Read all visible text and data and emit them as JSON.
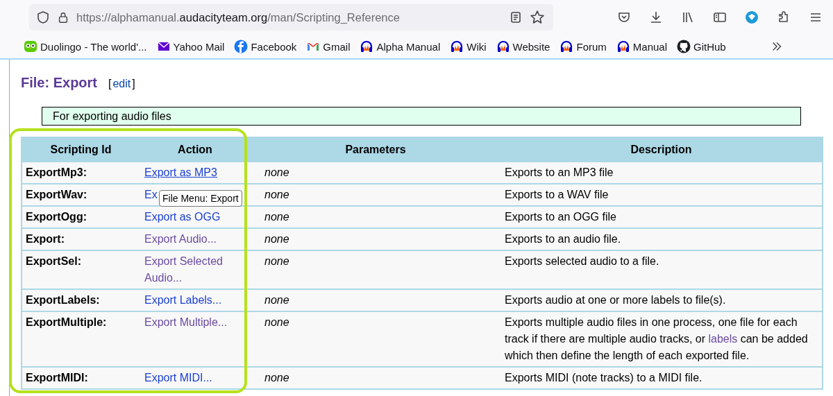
{
  "browser": {
    "url": {
      "prefix": "https://alphamanual.",
      "domain": "audacityteam.org",
      "path": "/man/Scripting_Reference"
    },
    "bookmarks": [
      {
        "label": "Duolingo - The world'..."
      },
      {
        "label": "Yahoo Mail"
      },
      {
        "label": "Facebook"
      },
      {
        "label": "Gmail"
      },
      {
        "label": "Alpha Manual"
      },
      {
        "label": "Wiki"
      },
      {
        "label": "Website"
      },
      {
        "label": "Forum"
      },
      {
        "label": "Manual"
      },
      {
        "label": "GitHub"
      }
    ]
  },
  "heading": {
    "title": "File: Export",
    "edit_open": "[",
    "edit_link": "edit",
    "edit_close": "]"
  },
  "note": "For exporting audio files",
  "table": {
    "columns": [
      "Scripting Id",
      "Action",
      "Parameters",
      "Description"
    ],
    "rows": [
      {
        "id": "ExportMp3:",
        "action": {
          "text": "Export as MP3",
          "visited": false,
          "hovered": true
        },
        "parameters": "none",
        "description": [
          {
            "text": "Exports to an MP3 file",
            "link": false
          }
        ]
      },
      {
        "id": "ExportWav:",
        "action": {
          "text": "Ex",
          "visited": false,
          "hovered": false
        },
        "tooltip": "File Menu: Export",
        "parameters": "none",
        "description": [
          {
            "text": "Exports to a WAV file",
            "link": false
          }
        ]
      },
      {
        "id": "ExportOgg:",
        "action": {
          "text": "Export as OGG",
          "visited": false,
          "hovered": false
        },
        "parameters": "none",
        "description": [
          {
            "text": "Exports to an OGG file",
            "link": false
          }
        ]
      },
      {
        "id": "Export:",
        "action": {
          "text": "Export Audio...",
          "visited": true,
          "hovered": false
        },
        "parameters": "none",
        "description": [
          {
            "text": "Exports to an audio file.",
            "link": false
          }
        ]
      },
      {
        "id": "ExportSel:",
        "action": {
          "text": "Export Selected Audio...",
          "visited": true,
          "hovered": false
        },
        "parameters": "none",
        "description": [
          {
            "text": "Exports selected audio to a file.",
            "link": false
          }
        ]
      },
      {
        "id": "ExportLabels:",
        "action": {
          "text": "Export Labels...",
          "visited": false,
          "hovered": false
        },
        "parameters": "none",
        "description": [
          {
            "text": "Exports audio at one or more labels to file(s).",
            "link": false
          }
        ]
      },
      {
        "id": "ExportMultiple:",
        "action": {
          "text": "Export Multiple...",
          "visited": true,
          "hovered": false
        },
        "parameters": "none",
        "description": [
          {
            "text": "Exports multiple audio files in one process, one file for each track if there are multiple audio tracks, or ",
            "link": false
          },
          {
            "text": "labels",
            "link": true
          },
          {
            "text": " can be added which then define the length of each exported file.",
            "link": false
          }
        ]
      },
      {
        "id": "ExportMIDI:",
        "action": {
          "text": "Export MIDI...",
          "visited": false,
          "hovered": false
        },
        "parameters": "none",
        "description": [
          {
            "text": "Exports MIDI (note tracks) to a MIDI file.",
            "link": false
          }
        ]
      }
    ]
  }
}
